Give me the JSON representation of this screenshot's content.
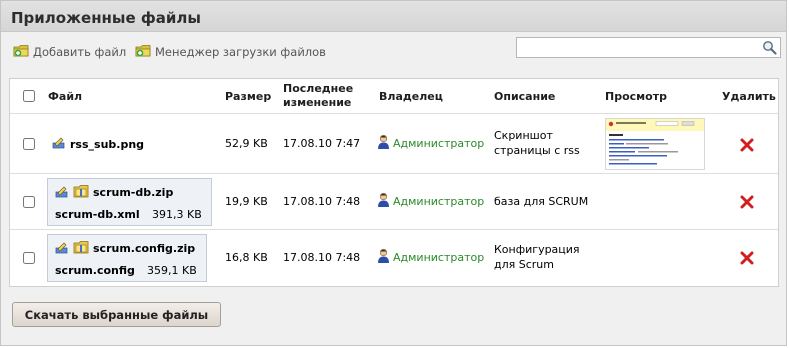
{
  "panel": {
    "title": "Приложенные файлы"
  },
  "toolbar": {
    "add_file_label": "Добавить файл",
    "upload_manager_label": "Менеджер загрузки файлов"
  },
  "search": {
    "value": "",
    "placeholder": ""
  },
  "table": {
    "headers": {
      "file": "Файл",
      "size": "Размер",
      "modified_line1": "Последнее",
      "modified_line2": "изменение",
      "owner": "Владелец",
      "description": "Описание",
      "preview": "Просмотр",
      "delete": "Удалить"
    },
    "rows": [
      {
        "name": "rss_sub.png",
        "size": "52,9 KB",
        "modified": "17.08.10 7:47",
        "owner": "Администратор",
        "description_line1": "Скриншот",
        "description_line2": "страницы с rss",
        "has_preview": true
      },
      {
        "name": "scrum-db.zip",
        "inner_name": "scrum-db.xml",
        "inner_size": "391,3 KB",
        "size": "19,9 KB",
        "modified": "17.08.10 7:48",
        "owner": "Администратор",
        "description_line1": "база для SCRUM",
        "description_line2": ""
      },
      {
        "name": "scrum.config.zip",
        "inner_name": "scrum.config",
        "inner_size": "359,1 KB",
        "size": "16,8 KB",
        "modified": "17.08.10 7:48",
        "owner": "Администратор",
        "description_line1": "Конфигурация",
        "description_line2": "для Scrum"
      }
    ]
  },
  "download_button_label": "Скачать выбранные файлы",
  "colors": {
    "owner_link": "#2b8a2b",
    "delete_icon": "#d11f1f",
    "header_bg": "#dcdcdc",
    "panel_bg": "#f0f0f0"
  },
  "icons": {
    "add_file": "folder-plus-icon",
    "upload_manager": "folder-plus-icon",
    "search": "magnifier-icon",
    "file_edit": "pencil-edit-icon",
    "archive": "zip-folder-icon",
    "owner": "user-icon",
    "delete": "red-x-icon"
  }
}
